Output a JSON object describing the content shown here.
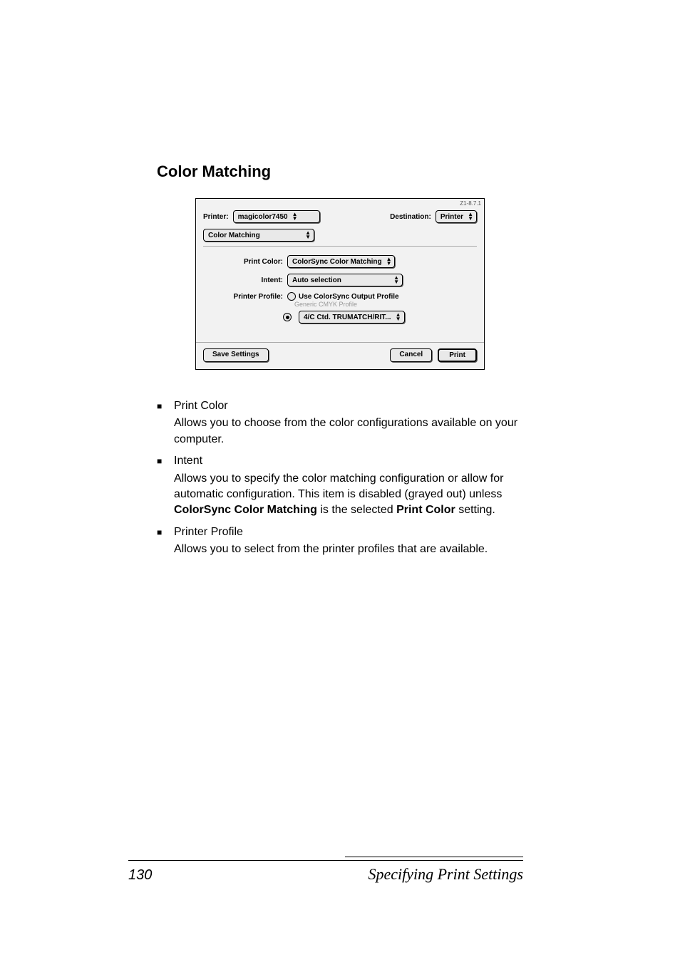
{
  "heading": "Color Matching",
  "dialog": {
    "version": "Z1-8.7.1",
    "printer_label": "Printer:",
    "printer_value": "magicolor7450",
    "destination_label": "Destination:",
    "destination_value": "Printer",
    "panel_value": "Color Matching",
    "print_color_label": "Print Color:",
    "print_color_value": "ColorSync Color Matching",
    "intent_label": "Intent:",
    "intent_value": "Auto selection",
    "printer_profile_label": "Printer Profile:",
    "radio1_label": "Use ColorSync Output Profile",
    "radio1_sub": "Generic CMYK Profile",
    "radio2_value": "4/C Ctd. TRUMATCH/RIT...",
    "save_button": "Save Settings",
    "cancel_button": "Cancel",
    "print_button": "Print"
  },
  "bullets": [
    {
      "title": "Print Color",
      "desc_plain": "Allows you to choose from the color configurations available on your computer."
    },
    {
      "title": "Intent",
      "desc_pre": "Allows you to specify the color matching configuration or allow for automatic configuration. This item is disabled (grayed out) unless ",
      "desc_bold1": "ColorSync Color Matching",
      "desc_mid": " is the selected ",
      "desc_bold2": "Print Color",
      "desc_post": " setting."
    },
    {
      "title": "Printer Profile",
      "desc_plain": "Allows you to select from the printer profiles that are available."
    }
  ],
  "footer": {
    "page_num": "130",
    "title": "Specifying Print Settings"
  }
}
